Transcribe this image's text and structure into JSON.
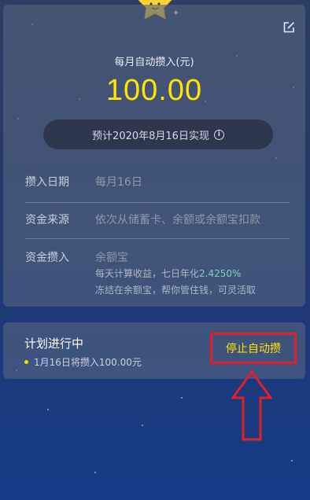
{
  "header": {
    "amount_caption": "每月自动攒入(元)",
    "amount": "100.00",
    "estimate": "预计2020年8月16日实现"
  },
  "details": {
    "rows": [
      {
        "label": "攒入日期",
        "value": "每月16日"
      },
      {
        "label": "资金来源",
        "value": "依次从储蓄卡、余额或余额宝扣款"
      },
      {
        "label": "资金攒入",
        "value": "余额宝"
      }
    ],
    "yield_prefix": "每天计算收益，七日年化",
    "yield_rate": "2.4250%",
    "frozen_note": "冻结在余额宝，帮你管住钱，可灵活取"
  },
  "plan": {
    "status": "计划进行中",
    "next": "1月16日将攒入100.00元",
    "stop_label": "停止自动攒"
  },
  "icons": {
    "edit": "edit-icon",
    "info": "info-icon",
    "mascot": "star-mascot-icon",
    "annotation": "up-arrow-icon"
  },
  "colors": {
    "amount": "#ffe600",
    "rate": "#7fd0c0",
    "stop_text": "#ffe100",
    "highlight": "#e01f2a"
  }
}
